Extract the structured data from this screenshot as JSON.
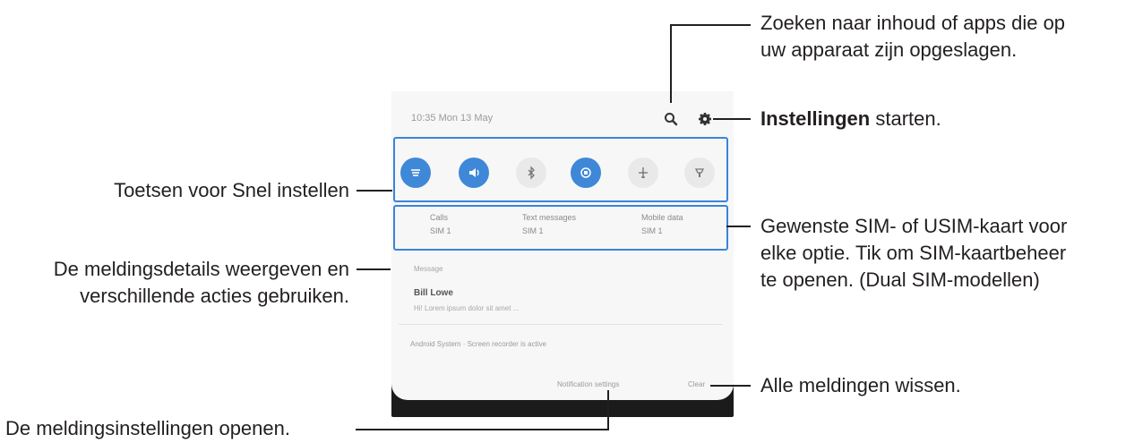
{
  "callouts": {
    "search": {
      "lines": [
        "Zoeken naar inhoud of apps die op",
        "uw apparaat zijn opgeslagen."
      ]
    },
    "settings": {
      "bold": "Instellingen",
      "rest": " starten."
    },
    "quick_settings": "Toetsen voor Snel instellen",
    "sim": {
      "lines": [
        "Gewenste SIM- of USIM-kaart voor",
        "elke optie. Tik om SIM-kaartbeheer",
        "te openen. (Dual SIM-modellen)"
      ]
    },
    "details": {
      "lines": [
        "De meldingsdetails weergeven en",
        "verschillende acties gebruiken."
      ]
    },
    "clear": "Alle meldingen wissen.",
    "notification_settings": "De meldingsinstellingen openen."
  },
  "phone": {
    "status_time": "10:35  Mon 13 May",
    "quick_buttons": [
      {
        "icon": "wifi-icon",
        "state": "on"
      },
      {
        "icon": "sound-icon",
        "state": "on"
      },
      {
        "icon": "bluetooth-icon",
        "state": "off"
      },
      {
        "icon": "rotate-icon",
        "state": "on"
      },
      {
        "icon": "airplane-mode-icon",
        "state": "off"
      },
      {
        "icon": "flashlight-icon",
        "state": "off"
      }
    ],
    "sim_options": [
      {
        "label": "Calls",
        "sim": "SIM 1"
      },
      {
        "label": "Text messages",
        "sim": "SIM 1"
      },
      {
        "label": "Mobile data",
        "sim": "SIM 1"
      }
    ],
    "notification": {
      "app": "Message",
      "title": "Bill Lowe",
      "body": "Hi! Lorem ipsum dolor sit amet ..."
    },
    "notification2": "Android System  ·  Screen recorder is active",
    "footer": {
      "settings_label": "Notification settings",
      "clear_label": "Clear"
    }
  },
  "colors": {
    "accent": "#3a84d9",
    "text": "#231f20"
  }
}
